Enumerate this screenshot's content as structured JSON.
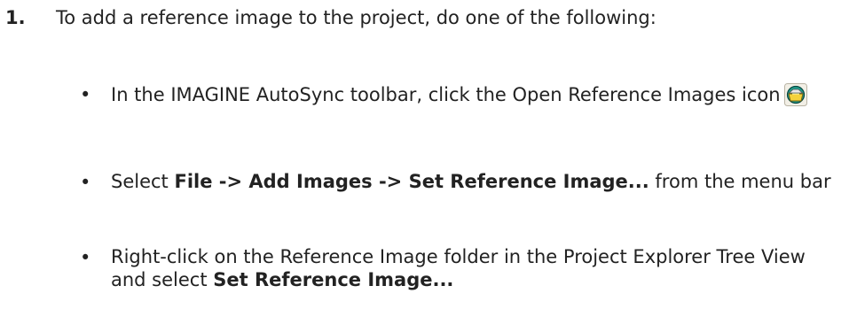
{
  "step": {
    "number": "1.",
    "text": "To add a reference image to the project, do one of the following:"
  },
  "bullets": [
    {
      "marker": "•",
      "text_before": "In the IMAGINE AutoSync toolbar, click the Open Reference Images icon",
      "icon": "open-reference-images-icon"
    },
    {
      "marker": "•",
      "text_before": "Select ",
      "bold": "File -> Add Images -> Set Reference Image...",
      "text_after": " from the menu bar"
    },
    {
      "marker": "•",
      "text_before": "Right-click on the Reference Image folder in the Project Explorer Tree View and select ",
      "bold": "Set Reference Image..."
    }
  ]
}
